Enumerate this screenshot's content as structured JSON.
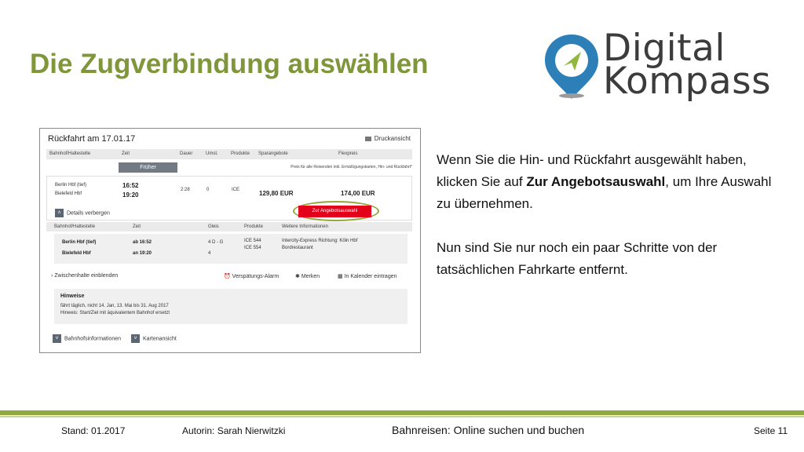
{
  "slide": {
    "title": "Die Zugverbindung auswählen"
  },
  "logo": {
    "line1": "Digital",
    "line2": "Kompass",
    "pin_colors": {
      "outer": "#2d7fb8",
      "inner": "#8fb83c"
    }
  },
  "screenshot": {
    "heading": "Rückfahrt am 17.01.17",
    "print_label": "Druckansicht",
    "columns": [
      "Bahnhof/Haltestelle",
      "Zeit",
      "Dauer",
      "Umst.",
      "Produkte",
      "Sparangebote",
      "Flexpreis"
    ],
    "earlier_button": "Früher",
    "price_note": "Preis für alle Reisenden inkl. Ermäßigungskarten, Hin- und Rückfahrt*",
    "connection": {
      "from_station": "Berlin Hbf (tief)",
      "to_station": "Bielefeld Hbf",
      "dep_time": "16:52",
      "arr_time": "19:20",
      "duration": "2:28",
      "changes": "0",
      "product": "ICE",
      "saver_price": "129,80 EUR",
      "flex_price": "174,00 EUR",
      "select_button": "Zur Angebotsauswahl",
      "hide_details": "Details verbergen"
    },
    "detail_columns": [
      "Bahnhof/Haltestelle",
      "Zeit",
      "Gleis",
      "Produkte",
      "Weitere Informationen"
    ],
    "detail": {
      "row1_station": "Berlin Hbf (tief)",
      "row1_time": "ab 16:52",
      "row1_platform": "4 D - G",
      "row1_product": "ICE 544",
      "row1_info": "Intercity-Express Richtung: Köln Hbf",
      "row2_station": "Bielefeld Hbf",
      "row2_time": "an 19:20",
      "row2_platform": "4",
      "row2_product": "ICE 554",
      "row2_info": "Bordrestaurant"
    },
    "show_stops": "Zwischenhalte einblenden",
    "alarm": "Verspätungs-Alarm",
    "bookmark": "Merken",
    "calendar": "In Kalender eintragen",
    "notes_title": "Hinweise",
    "notes_line1": "fährt täglich, nicht 14. Jan, 13. Mai bis 31. Aug 2017",
    "notes_line2": "Hinweis: Start/Ziel mit äquivalentem Bahnhof ersetzt",
    "station_info": "Bahnhofsinformationen",
    "map_view": "Kartenansicht"
  },
  "text": {
    "p1_a": "Wenn Sie die Hin- und Rückfahrt ausgewählt haben, klicken Sie auf ",
    "p1_bold": "Zur Angebotsauswahl",
    "p1_b": ", um Ihre Auswahl zu übernehmen.",
    "p2": "Nun sind Sie nur noch ein paar Schritte von der tatsächlichen Fahrkarte entfernt."
  },
  "footer": {
    "stand": "Stand: 01.2017",
    "author": "Autorin: Sarah Nierwitzki",
    "topic": "Bahnreisen: Online suchen und buchen",
    "page": "Seite 11"
  },
  "colors": {
    "title": "#7f963a",
    "accent_bar": "#8ea93d",
    "db_red": "#e2001a"
  }
}
